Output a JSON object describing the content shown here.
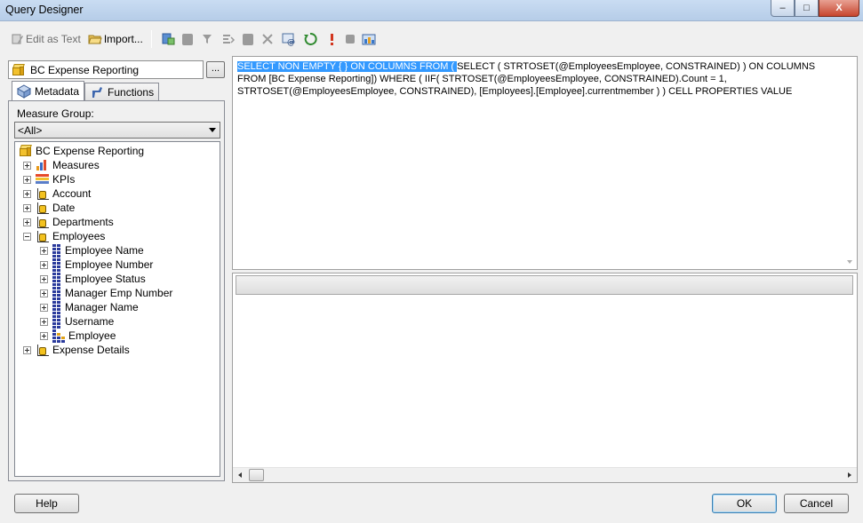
{
  "window": {
    "title": "Query Designer",
    "minimize": "–",
    "maximize": "□",
    "close": "X"
  },
  "toolbar": {
    "edit_as_text": "Edit as Text",
    "import": "Import..."
  },
  "cube_selector": {
    "value": "BC Expense Reporting",
    "button": "..."
  },
  "tabs": [
    {
      "label": "Metadata",
      "active": true
    },
    {
      "label": "Functions",
      "active": false
    }
  ],
  "measure_group": {
    "label": "Measure Group:",
    "value": "<All>"
  },
  "tree": {
    "root": "BC Expense Reporting",
    "items": [
      {
        "label": "Measures",
        "icon": "measures-icon"
      },
      {
        "label": "KPIs",
        "icon": "kpi-icon"
      },
      {
        "label": "Account",
        "icon": "dimension-icon"
      },
      {
        "label": "Date",
        "icon": "dimension-icon"
      },
      {
        "label": "Departments",
        "icon": "dimension-icon"
      },
      {
        "label": "Employees",
        "icon": "dimension-icon",
        "expanded": true
      }
    ],
    "employee_children": [
      "Employee Name",
      "Employee Number",
      "Employee Status",
      "Manager Emp Number",
      "Manager Name",
      "Username",
      "Employee"
    ],
    "last": "Expense Details"
  },
  "query": {
    "selected": " SELECT NON EMPTY { } ON COLUMNS FROM ( ",
    "rest": "SELECT ( STRTOSET(@EmployeesEmployee, CONSTRAINED) ) ON COLUMNS FROM [BC Expense Reporting]) WHERE ( IIF( STRTOSET(@EmployeesEmployee, CONSTRAINED).Count = 1, STRTOSET(@EmployeesEmployee, CONSTRAINED), [Employees].[Employee].currentmember ) ) CELL PROPERTIES VALUE"
  },
  "buttons": {
    "help": "Help",
    "ok": "OK",
    "cancel": "Cancel"
  }
}
